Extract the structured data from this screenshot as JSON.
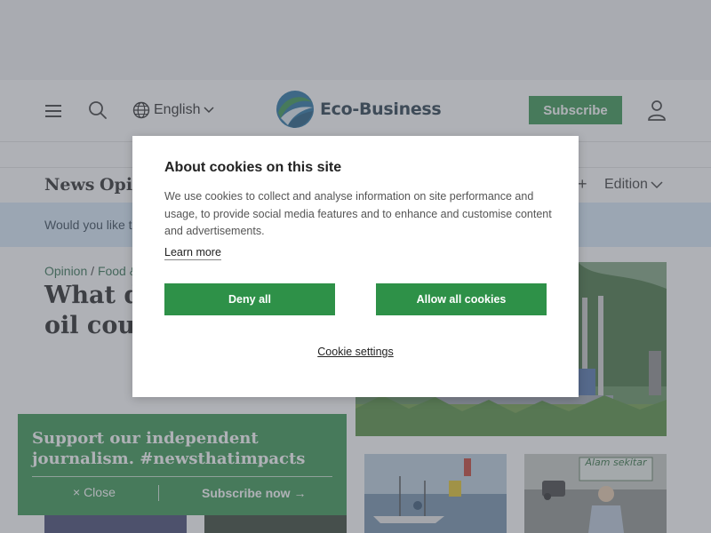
{
  "header": {
    "language": "English",
    "logo_text": "Eco-Business",
    "subscribe_label": "Subscribe",
    "icons": [
      "hamburger-menu-icon",
      "search-icon",
      "globe-icon",
      "chevron-down-icon",
      "user-icon"
    ]
  },
  "nav": {
    "items": [
      "News",
      "Opin"
    ],
    "plus": "+",
    "edition": "Edition"
  },
  "banner": {
    "text": "Would you like to"
  },
  "article": {
    "category": "Opinion",
    "separator": "/",
    "subcategory": "Food &",
    "headline_line1": "What de",
    "headline_line2": "oil could"
  },
  "support_bar": {
    "title": "Support our independent journalism. #newsthatimpacts",
    "close_label": "× Close",
    "subscribe_label": "Subscribe now →"
  },
  "cookie_modal": {
    "title": "About cookies on this site",
    "body": "We use cookies to collect and analyse information on site performance and usage, to provide social media features and to enhance and customise content and advertisements.",
    "learn_more": "Learn more",
    "deny_label": "Deny all",
    "allow_label": "Allow all cookies",
    "settings_label": "Cookie settings"
  },
  "photos": {
    "protest_sign": "Alam sekitar"
  },
  "colors": {
    "brand_green": "#2e9148",
    "logo_navy": "#1d3342",
    "banner_blue": "#d6e9f9",
    "overlay": "rgba(95,100,110,0.5)"
  }
}
